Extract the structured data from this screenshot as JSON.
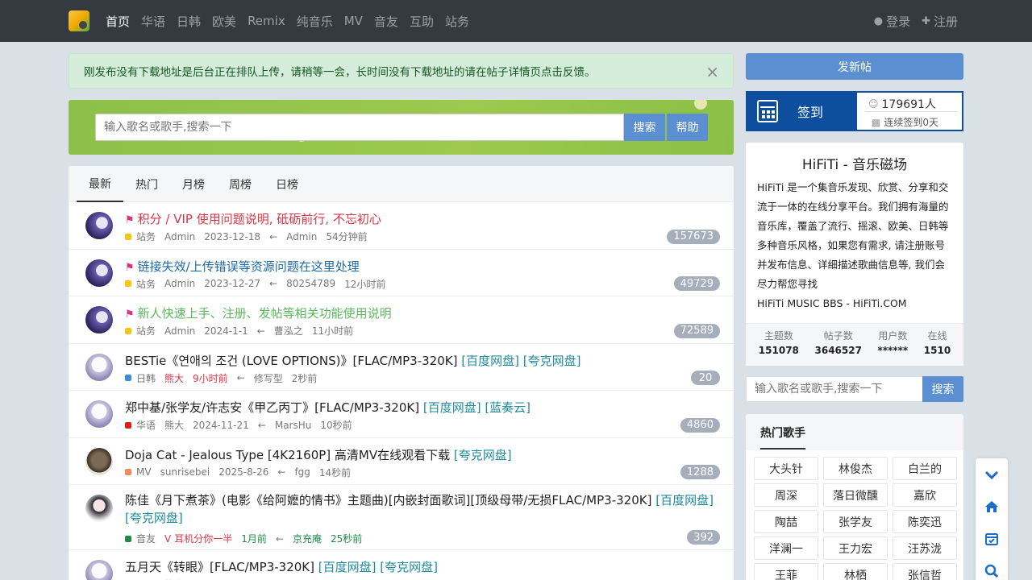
{
  "nav": {
    "items": [
      "首页",
      "华语",
      "日韩",
      "欧美",
      "Remix",
      "纯音乐",
      "MV",
      "音友",
      "互助",
      "站务"
    ],
    "login": "登录",
    "register": "注册"
  },
  "alert": {
    "text": "刚发布没有下载地址是后台正在排队上传，请稍等一会，长时间没有下载地址的请在帖子详情页点击反馈。",
    "close": "×"
  },
  "search": {
    "placeholder": "输入歌名或歌手,搜索一下",
    "button": "搜索",
    "help": "帮助"
  },
  "tabs": [
    "最新",
    "热门",
    "月榜",
    "周榜",
    "日榜"
  ],
  "threads": [
    {
      "title": "积分 / VIP 使用问题说明, 砥砺前行, 不忘初心",
      "style": "red",
      "flag": true,
      "category": "站务",
      "cat_color": "#f5c518",
      "author": "Admin",
      "date": "2023-12-18",
      "last_user": "Admin",
      "last_time": "54分钟前",
      "count": "157673",
      "avatar": "v1"
    },
    {
      "title": "链接失效/上传错误等资源问题在这里处理",
      "style": "blue",
      "flag": true,
      "category": "站务",
      "cat_color": "#f5c518",
      "author": "Admin",
      "date": "2023-12-27",
      "last_user": "80254789",
      "last_time": "12小时前",
      "count": "49729",
      "avatar": "v1"
    },
    {
      "title": "新人快速上手、注册、发帖等相关功能使用说明",
      "style": "green",
      "flag": true,
      "category": "站务",
      "cat_color": "#f5c518",
      "author": "Admin",
      "date": "2024-1-1",
      "last_user": "曹泓之",
      "last_time": "11小时前",
      "count": "72589",
      "avatar": "v1"
    },
    {
      "title": "BESTie《연애의 조건 (LOVE OPTIONS)》[FLAC/MP3-320K]",
      "links": "[百度网盘] [夸克网盘]",
      "style": "",
      "category": "日韩",
      "cat_color": "#3b8ede",
      "author": "熊大",
      "author_hot": true,
      "date": "9小时前",
      "date_hot": true,
      "last_user": "修写型",
      "last_time": "2秒前",
      "count": "20",
      "avatar": "v2"
    },
    {
      "title": "郑中基/张学友/许志安《甲乙丙丁》[FLAC/MP3-320K]",
      "links": "[百度网盘] [蓝奏云]",
      "style": "",
      "category": "华语",
      "cat_color": "#e01e1e",
      "author": "熊大",
      "date": "2024-11-21",
      "last_user": "MarsHu",
      "last_time": "10秒前",
      "count": "4860",
      "avatar": "v2"
    },
    {
      "title": "Doja Cat - Jealous Type [4K2160P] 高清MV在线观看下载",
      "links": "[夸克网盘]",
      "style": "",
      "category": "MV",
      "cat_color": "#f28b5a",
      "author": "sunrisebei",
      "date": "2025-8-26",
      "last_user": "fgg",
      "last_time": "14秒前",
      "count": "1288",
      "avatar": "v3"
    },
    {
      "title": "陈佳《月下煮茶》(电影《给阿嬷的情书》主题曲)[内嵌封面歌词][顶级母带/无损FLAC/MP3-320K]",
      "links": "[百度网盘] [夸克网盘]",
      "style": "",
      "tall": true,
      "category": "音友",
      "cat_color": "#1e8b48",
      "author": "耳机分你一半",
      "author_v": true,
      "date": "1月前",
      "date_green": true,
      "last_user": "京充庵",
      "last_user_green": true,
      "last_time": "25秒前",
      "last_time_green": true,
      "count": "392",
      "avatar": "v4"
    },
    {
      "title": "五月天《转眼》[FLAC/MP3-320K]",
      "links": "[百度网盘] [夸克网盘]",
      "style": "",
      "category": "华语",
      "cat_color": "#e01e1e",
      "author": "熊大",
      "date": "",
      "last_user": "",
      "last_time": "",
      "count": "",
      "avatar": "v2"
    }
  ],
  "sidebar": {
    "new_post": "发新帖",
    "checkin": {
      "label": "签到",
      "people": "179691人",
      "days": "连续签到0天"
    },
    "about": {
      "title": "HiFiTi - 音乐磁场",
      "text": "HiFiTi 是一个集音乐发现、欣赏、分享和交流于一体的在线分享平台。我们拥有海量的音乐库，覆盖了流行、摇滚、欧美、日韩等多种音乐风格，如果您有需求, 请注册账号并发布信息、详细描述歌曲信息等, 我们会尽力帮您寻找",
      "footer": "HiFiTi MUSIC BBS - HiFiTi.COM"
    },
    "stats": [
      {
        "label": "主题数",
        "value": "151078"
      },
      {
        "label": "帖子数",
        "value": "3646527"
      },
      {
        "label": "用户数",
        "value": "******"
      },
      {
        "label": "在线",
        "value": "1510"
      }
    ],
    "search": {
      "placeholder": "输入歌名或歌手,搜索一下",
      "button": "搜索"
    },
    "hot_singers_title": "热门歌手",
    "hot_singers": [
      "大头针",
      "林俊杰",
      "白兰的",
      "周深",
      "落日微醺",
      "嘉欣",
      "陶喆",
      "张学友",
      "陈奕迅",
      "洋澜一",
      "王力宏",
      "汪苏泷",
      "王菲",
      "林栖",
      "张信哲"
    ]
  },
  "colors": {
    "navbar": "#343a40",
    "accent_blue": "#5b8fd1",
    "checkin_blue": "#0d4f9e",
    "banner_green": "#8bc34a"
  }
}
